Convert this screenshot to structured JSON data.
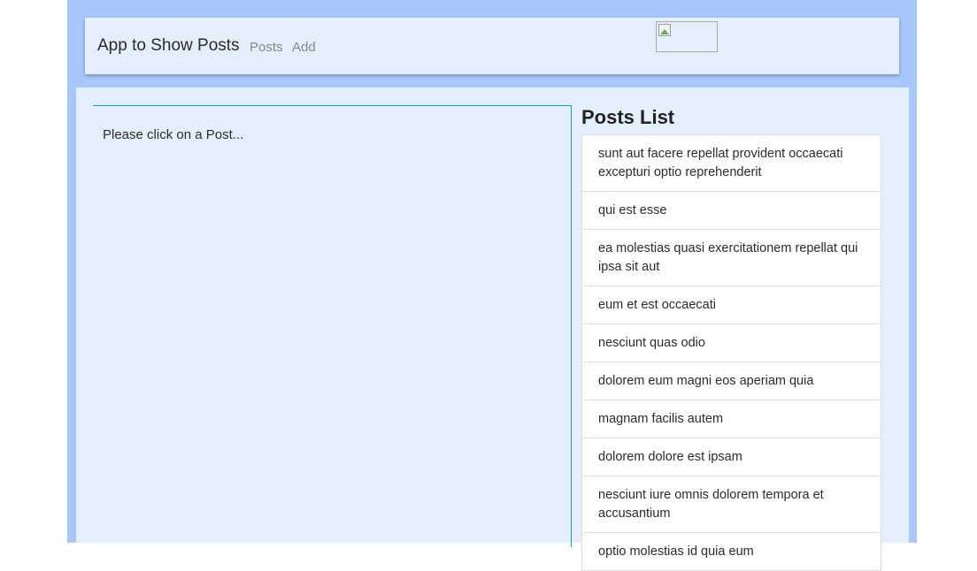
{
  "navbar": {
    "brand": "App to Show Posts",
    "links": [
      "Posts",
      "Add"
    ]
  },
  "detail": {
    "placeholder": "Please click on a Post..."
  },
  "posts": {
    "title": "Posts List",
    "items": [
      "sunt aut facere repellat provident occaecati excepturi optio reprehenderit",
      "qui est esse",
      "ea molestias quasi exercitationem repellat qui ipsa sit aut",
      "eum et est occaecati",
      "nesciunt quas odio",
      "dolorem eum magni eos aperiam quia",
      "magnam facilis autem",
      "dolorem dolore est ipsam",
      "nesciunt iure omnis dolorem tempora et accusantium",
      "optio molestias id quia eum"
    ]
  },
  "colors": {
    "page_background": "#a8c8fc",
    "panel_background": "#e3f0fc",
    "detail_border": "#17a2b8",
    "list_item_background": "#ffffff"
  }
}
